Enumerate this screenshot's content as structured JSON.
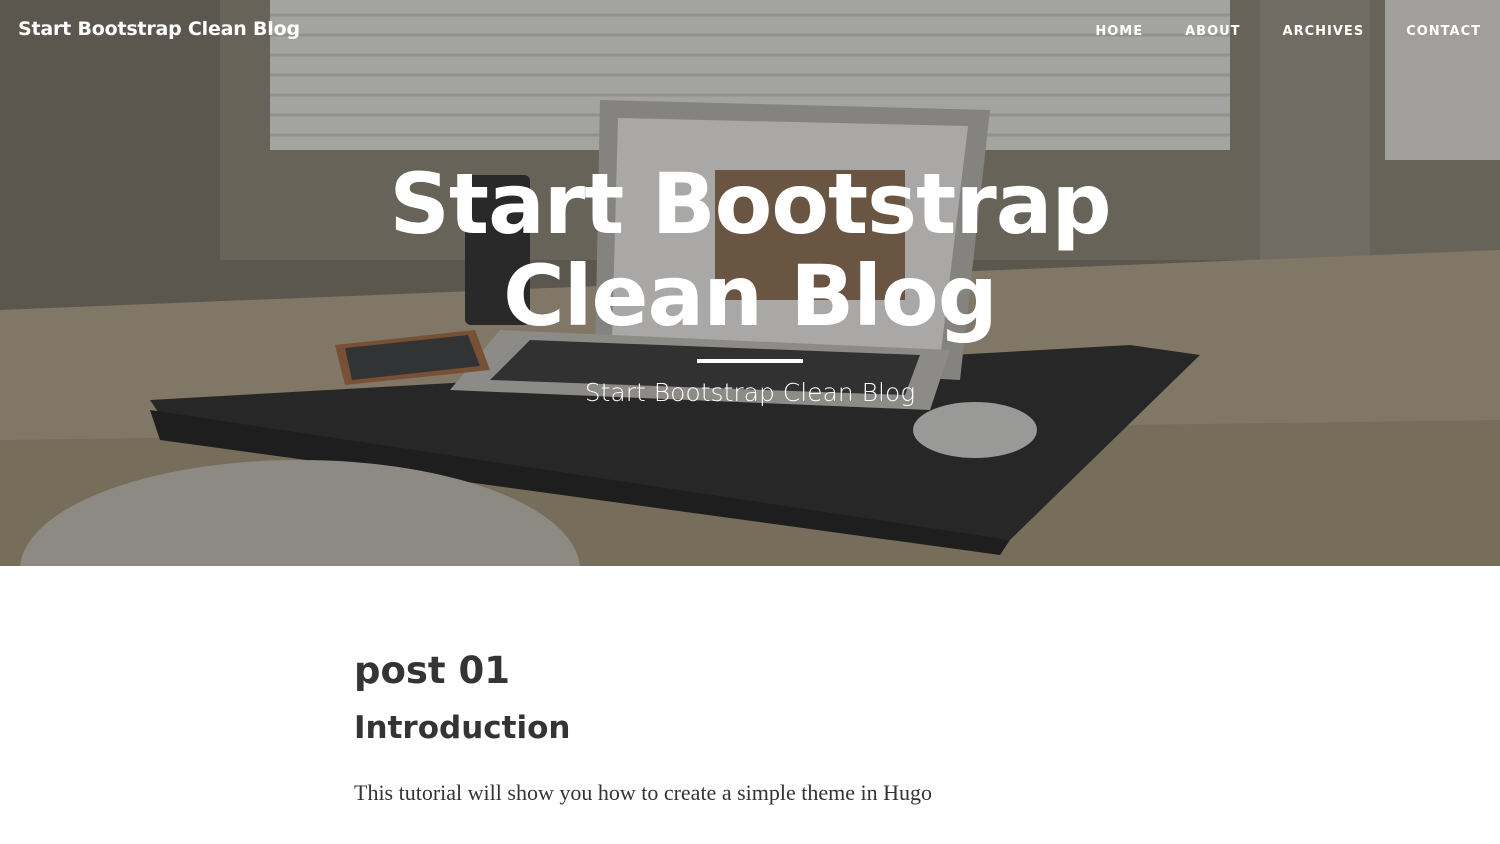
{
  "navbar": {
    "brand": "Start Bootstrap Clean Blog",
    "links": [
      "HOME",
      "ABOUT",
      "ARCHIVES",
      "CONTACT"
    ]
  },
  "hero": {
    "title_line1": "Start Bootstrap",
    "title_line2": "Clean Blog",
    "subtitle": "Start Bootstrap Clean Blog",
    "background_image": "desk-with-laptop-photo"
  },
  "post": {
    "title": "post 01",
    "heading": "Introduction",
    "text": "This tutorial will show you how to create a simple theme in Hugo"
  },
  "colors": {
    "hero_overlay": "#212529",
    "heading_text": "#343434",
    "body_text": "#333333",
    "white": "#ffffff"
  }
}
